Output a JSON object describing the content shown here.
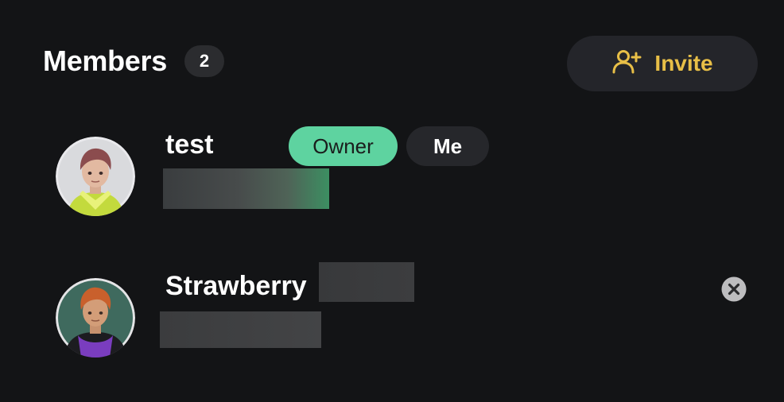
{
  "header": {
    "title": "Members",
    "member_count": "2",
    "invite_label": "Invite",
    "invite_icon": "add-user-icon"
  },
  "members": [
    {
      "name": "test",
      "badges": [
        "Owner",
        "Me"
      ],
      "avatar_icon": "avatar-image",
      "detail_redacted": true
    },
    {
      "name": "Strawberry",
      "badges": [],
      "avatar_icon": "avatar-image",
      "detail_redacted": true,
      "action_icon": "remove-icon"
    }
  ],
  "colors": {
    "background": "#131416",
    "accent": "#e8bf47",
    "owner_badge": "#5ed3a0",
    "badge_dark": "#26272b"
  }
}
